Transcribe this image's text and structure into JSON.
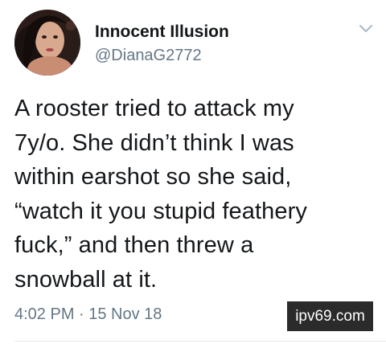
{
  "tweet": {
    "display_name": "Innocent Illusion",
    "handle": "@DianaG2772",
    "text": "A rooster tried to attack my\n7y/o. She didn’t think I was\nwithin earshot so she said,\n“watch it you stupid feathery\nfuck,” and then threw a\nsnowball at it.",
    "timestamp": "4:02 PM · 15 Nov 18"
  },
  "watermark": {
    "text": "ipv69.com"
  },
  "colors": {
    "text_primary": "#14171a",
    "text_secondary": "#657786",
    "watermark_bg": "#2b2b2b",
    "divider": "#e6ecf0"
  },
  "icons": {
    "menu": "chevron-down-icon",
    "avatar": "avatar"
  }
}
